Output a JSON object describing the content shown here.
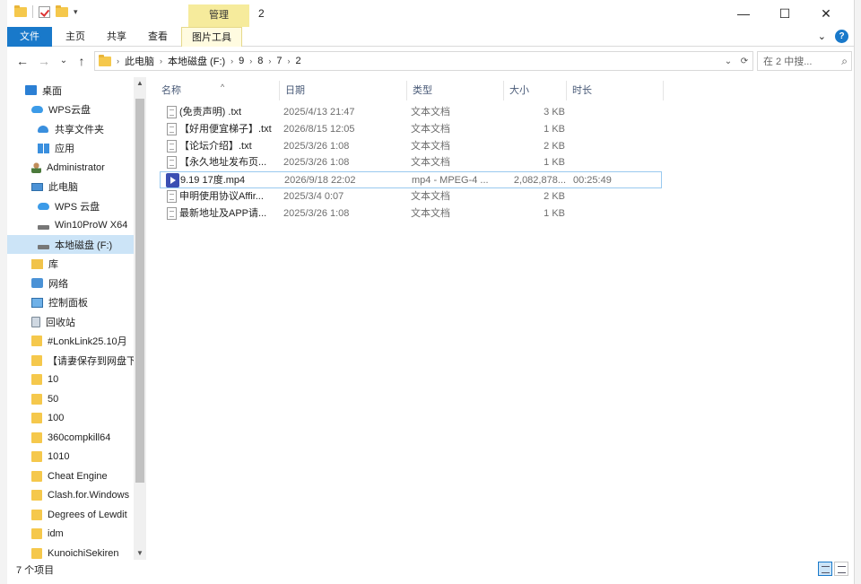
{
  "window": {
    "title": "2",
    "context_tab_header": "管理",
    "controls": [
      "—",
      "☐",
      "✕"
    ]
  },
  "ribbon": {
    "tabs": [
      "文件",
      "主页",
      "共享",
      "查看",
      "图片工具"
    ],
    "chevron": "⌄",
    "help": "?"
  },
  "address": {
    "back": "←",
    "forward": "→",
    "recent": "⌄",
    "up": "↑",
    "breadcrumb": [
      "此电脑",
      "本地磁盘 (F:)",
      "9",
      "8",
      "7",
      "2"
    ],
    "separator": "›",
    "dropdown": "⌄",
    "refresh": "⟳",
    "search_placeholder": "在 2 中搜...",
    "search_icon": "search-icon"
  },
  "nav": {
    "items": [
      {
        "label": "桌面",
        "icon": "desktop-icon",
        "indent": 0
      },
      {
        "label": "WPS云盘",
        "icon": "cloud-icon",
        "indent": 1
      },
      {
        "label": "共享文件夹",
        "icon": "share-folder-icon",
        "indent": 2
      },
      {
        "label": "应用",
        "icon": "apps-icon",
        "indent": 2
      },
      {
        "label": "Administrator",
        "icon": "user-icon",
        "indent": 1
      },
      {
        "label": "此电脑",
        "icon": "pc-icon",
        "indent": 1
      },
      {
        "label": "WPS 云盘",
        "icon": "cloud-icon",
        "indent": 2
      },
      {
        "label": "Win10ProW X64",
        "icon": "drive-icon",
        "indent": 2
      },
      {
        "label": "本地磁盘 (F:)",
        "icon": "drive-icon",
        "indent": 2,
        "selected": true
      },
      {
        "label": "库",
        "icon": "library-icon",
        "indent": 1
      },
      {
        "label": "网络",
        "icon": "network-icon",
        "indent": 1
      },
      {
        "label": "控制面板",
        "icon": "control-panel-icon",
        "indent": 1
      },
      {
        "label": "回收站",
        "icon": "recycle-bin-icon",
        "indent": 1
      },
      {
        "label": "#LonkLink25.10月",
        "icon": "folder-icon",
        "indent": 1
      },
      {
        "label": "【请妻保存到网盘下",
        "icon": "folder-icon",
        "indent": 1
      },
      {
        "label": "10",
        "icon": "folder-icon",
        "indent": 1
      },
      {
        "label": "50",
        "icon": "folder-icon",
        "indent": 1
      },
      {
        "label": "100",
        "icon": "folder-icon",
        "indent": 1
      },
      {
        "label": "360compkill64",
        "icon": "folder-icon",
        "indent": 1
      },
      {
        "label": "1010",
        "icon": "folder-icon",
        "indent": 1
      },
      {
        "label": "Cheat Engine",
        "icon": "folder-icon",
        "indent": 1
      },
      {
        "label": "Clash.for.Windows",
        "icon": "folder-icon",
        "indent": 1
      },
      {
        "label": "Degrees of Lewdit",
        "icon": "folder-icon",
        "indent": 1
      },
      {
        "label": "idm",
        "icon": "folder-icon",
        "indent": 1
      },
      {
        "label": "KunoichiSekiren",
        "icon": "folder-icon",
        "indent": 1
      }
    ]
  },
  "files": {
    "columns": [
      "名称",
      "日期",
      "类型",
      "大小",
      "时长"
    ],
    "rows": [
      {
        "name": "(免责声明) .txt",
        "date": "2025/4/13 21:47",
        "type": "文本文档",
        "size": "3 KB",
        "duration": "",
        "kind": "txt"
      },
      {
        "name": "【好用便宜梯子】.txt",
        "date": "2026/8/15 12:05",
        "type": "文本文档",
        "size": "1 KB",
        "duration": "",
        "kind": "txt"
      },
      {
        "name": "【论坛介绍】.txt",
        "date": "2025/3/26 1:08",
        "type": "文本文档",
        "size": "2 KB",
        "duration": "",
        "kind": "txt"
      },
      {
        "name": "【永久地址发布页...",
        "date": "2025/3/26 1:08",
        "type": "文本文档",
        "size": "1 KB",
        "duration": "",
        "kind": "txt"
      },
      {
        "name": "9.19 17度.mp4",
        "date": "2026/9/18 22:02",
        "type": "mp4 - MPEG-4 ...",
        "size": "2,082,878...",
        "duration": "00:25:49",
        "kind": "video",
        "highlighted": true
      },
      {
        "name": "申明使用协议Affir...",
        "date": "2025/3/4 0:07",
        "type": "文本文档",
        "size": "2 KB",
        "duration": "",
        "kind": "txt"
      },
      {
        "name": "最新地址及APP请...",
        "date": "2025/3/26 1:08",
        "type": "文本文档",
        "size": "1 KB",
        "duration": "",
        "kind": "txt"
      }
    ]
  },
  "status": {
    "count": "7 个项目"
  }
}
